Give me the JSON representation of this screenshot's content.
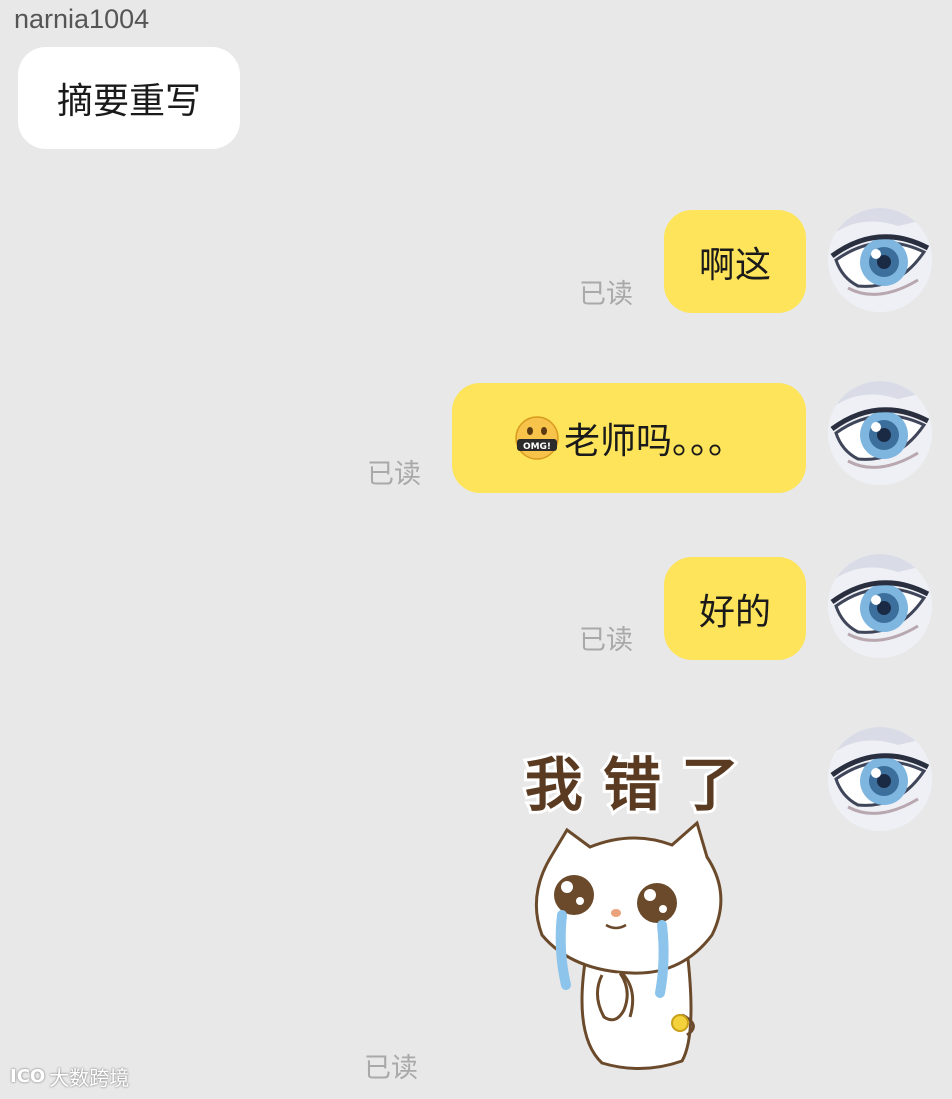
{
  "conversation": {
    "sender_name": "narnia1004",
    "incoming": [
      {
        "text": "摘要重写"
      }
    ],
    "outgoing": [
      {
        "text": "啊这",
        "status": "已读"
      },
      {
        "emoji": "omg-face-emoji",
        "text": "老师吗。。。",
        "status": "已读"
      },
      {
        "text": "好的",
        "status": "已读"
      },
      {
        "sticker_caption": "我 错 了",
        "status": "已读"
      }
    ]
  },
  "watermark": {
    "logo": "ICO",
    "text": "大数跨境"
  },
  "colors": {
    "background": "#e8e8e8",
    "incoming_bubble": "#ffffff",
    "outgoing_bubble": "#fde45a",
    "read_receipt": "#a9a9a9"
  },
  "icons": [
    "omg-face-emoji",
    "anime-eye-avatar",
    "crying-cat-sticker"
  ]
}
